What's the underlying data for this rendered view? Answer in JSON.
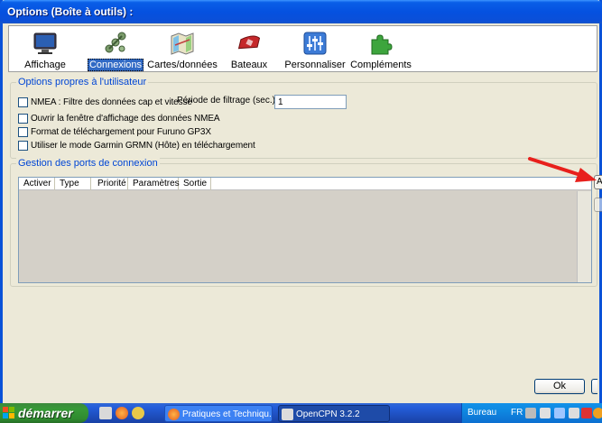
{
  "window": {
    "title": "Options (Boîte à outils) :"
  },
  "toolbar": {
    "items": [
      {
        "label": "Affichage",
        "icon": "monitor-icon",
        "selected": false
      },
      {
        "label": "Connexions",
        "icon": "connections-icon",
        "selected": true
      },
      {
        "label": "Cartes/données",
        "icon": "charts-icon",
        "selected": false
      },
      {
        "label": "Bateaux",
        "icon": "boat-icon",
        "selected": false
      },
      {
        "label": "Personnaliser",
        "icon": "sliders-icon",
        "selected": false
      },
      {
        "label": "Compléments",
        "icon": "puzzle-icon",
        "selected": false
      }
    ]
  },
  "user_options": {
    "title": "Options propres à l'utilisateur",
    "nmea_filter": "NMEA : Filtre des données cap et vitesse",
    "filter_period_label": "Période de filtrage (sec.)",
    "filter_period_value": "1",
    "open_nmea_window": "Ouvrir la fenêtre d'affichage des données NMEA",
    "furuno_format": "Format de téléchargement pour Furuno GP3X",
    "garmin_mode": "Utiliser le mode Garmin GRMN (Hôte) en téléchargement"
  },
  "ports": {
    "title": "Gestion des ports de connexion",
    "columns": [
      "Activer",
      "Type",
      "Priorité",
      "Paramètres",
      "Sortie"
    ],
    "add_button": "A",
    "remove_button": ""
  },
  "buttons": {
    "ok": "Ok",
    "cancel": ""
  },
  "taskbar": {
    "start": "démarrer",
    "tasks": [
      {
        "label": "Pratiques et Techniqu..."
      },
      {
        "label": "OpenCPN 3.2.2"
      }
    ],
    "tray": {
      "label": "Bureau",
      "lang": "FR"
    }
  },
  "colors": {
    "arrow": "#e8201c",
    "accent": "#0046d5"
  }
}
